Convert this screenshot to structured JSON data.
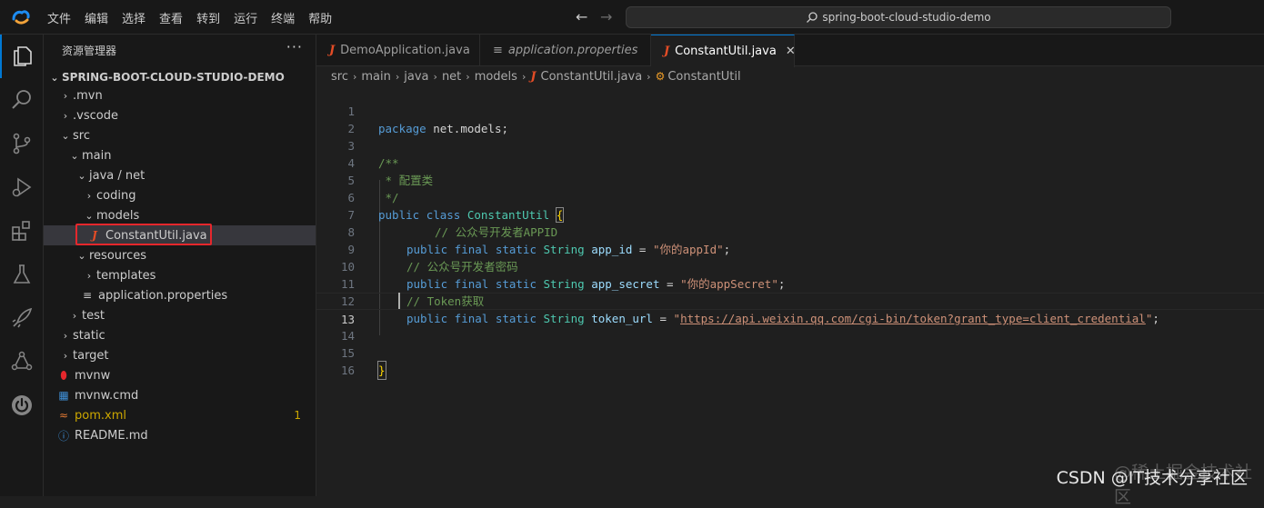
{
  "titlebar": {
    "menu": [
      "文件",
      "编辑",
      "选择",
      "查看",
      "转到",
      "运行",
      "终端",
      "帮助"
    ],
    "search_text": "spring-boot-cloud-studio-demo"
  },
  "activity_bar": {
    "icons": [
      "files-icon",
      "search-icon",
      "source-control-icon",
      "run-debug-icon",
      "extensions-icon",
      "testing-icon",
      "remote-icon",
      "share-icon",
      "spring-boot-icon"
    ]
  },
  "sidebar": {
    "title": "资源管理器",
    "more": "···",
    "root": "SPRING-BOOT-CLOUD-STUDIO-DEMO",
    "tree": [
      {
        "label": ".mvn"
      },
      {
        "label": ".vscode"
      },
      {
        "label": "src"
      },
      {
        "label": "main"
      },
      {
        "label": "java / net"
      },
      {
        "label": "coding"
      },
      {
        "label": "models"
      },
      {
        "label": "ConstantUtil.java"
      },
      {
        "label": "resources"
      },
      {
        "label": "templates"
      },
      {
        "label": "application.properties"
      },
      {
        "label": "test"
      },
      {
        "label": "static"
      },
      {
        "label": "target"
      },
      {
        "label": "mvnw"
      },
      {
        "label": "mvnw.cmd"
      },
      {
        "label": "pom.xml",
        "badge": "1"
      },
      {
        "label": "README.md"
      }
    ]
  },
  "tabs": [
    {
      "label": "DemoApplication.java"
    },
    {
      "label": "application.properties"
    },
    {
      "label": "ConstantUtil.java",
      "close": "✕"
    }
  ],
  "breadcrumb": [
    "src",
    "main",
    "java",
    "net",
    "models",
    "ConstantUtil.java",
    "ConstantUtil"
  ],
  "code": {
    "line_numbers": [
      "1",
      "2",
      "3",
      "4",
      "5",
      "6",
      "7",
      "8",
      "9",
      "10",
      "11",
      "12",
      "13",
      "14",
      "15",
      "16"
    ],
    "l1_kw": "package",
    "l1_rest": " net.models;",
    "l3": "/**",
    "l4": " * 配置类",
    "l5": " */",
    "l6_public": "public",
    "l6_class": "class",
    "l6_name": "ConstantUtil",
    "l6_brace": "{",
    "l7": "// 公众号开发者APPID",
    "l8_mods": "public final static",
    "l8_type": "String",
    "l8_var": "app_id",
    "l8_eq": " = ",
    "l8_val": "\"你的appId\"",
    "l8_end": ";",
    "l9": "// 公众号开发者密码",
    "l10_mods": "public final static",
    "l10_type": "String",
    "l10_var": "app_secret",
    "l10_eq": " = ",
    "l10_val": "\"你的appSecret\"",
    "l10_end": ";",
    "l11": "// Token获取",
    "l12_mods": "public final static",
    "l12_type": "String",
    "l12_var": "token_url",
    "l12_eq": " = ",
    "l12_q1": "\"",
    "l12_url": "https://api.weixin.qq.com/cgi-bin/token?grant_type=client_credential",
    "l12_q2": "\"",
    "l12_end": ";",
    "l15": "}"
  },
  "watermark": {
    "faint": "@稀土掘金技术社区",
    "text": "CSDN @IT技术分享社区"
  }
}
